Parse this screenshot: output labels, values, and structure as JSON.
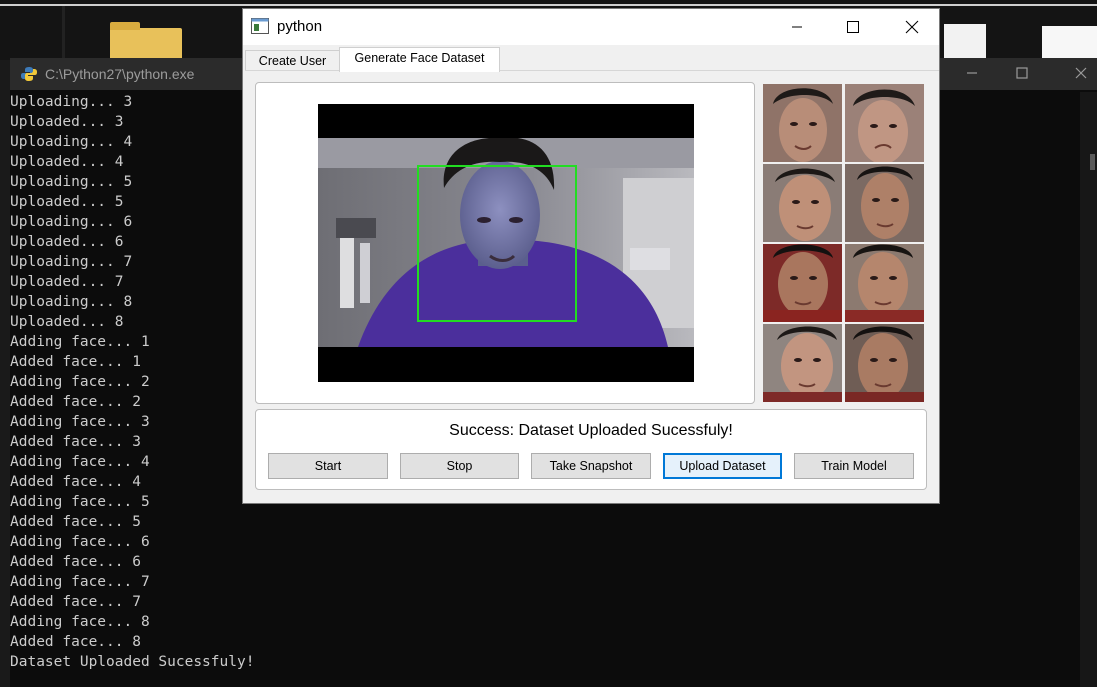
{
  "console": {
    "title": "C:\\Python27\\python.exe",
    "lines": [
      "Uploading... 3",
      "Uploaded... 3",
      "Uploading... 4",
      "Uploaded... 4",
      "Uploading... 5",
      "Uploaded... 5",
      "Uploading... 6",
      "Uploaded... 6",
      "Uploading... 7",
      "Uploaded... 7",
      "Uploading... 8",
      "Uploaded... 8",
      "Adding face... 1",
      "Added face... 1",
      "Adding face... 2",
      "Added face... 2",
      "Adding face... 3",
      "Added face... 3",
      "Adding face... 4",
      "Added face... 4",
      "Adding face... 5",
      "Added face... 5",
      "Adding face... 6",
      "Added face... 6",
      "Adding face... 7",
      "Added face... 7",
      "Adding face... 8",
      "Added face... 8",
      "Dataset Uploaded Sucessfuly!"
    ]
  },
  "app": {
    "title": "python",
    "tabs": [
      {
        "label": "Create User",
        "active": false
      },
      {
        "label": "Generate Face Dataset",
        "active": true
      }
    ],
    "status": "Success: Dataset Uploaded Sucessfuly!",
    "buttons": {
      "start": "Start",
      "stop": "Stop",
      "snapshot": "Take Snapshot",
      "upload": "Upload Dataset",
      "train": "Train Model"
    },
    "focused_button": "upload",
    "detection_box_color": "#22dd22"
  }
}
